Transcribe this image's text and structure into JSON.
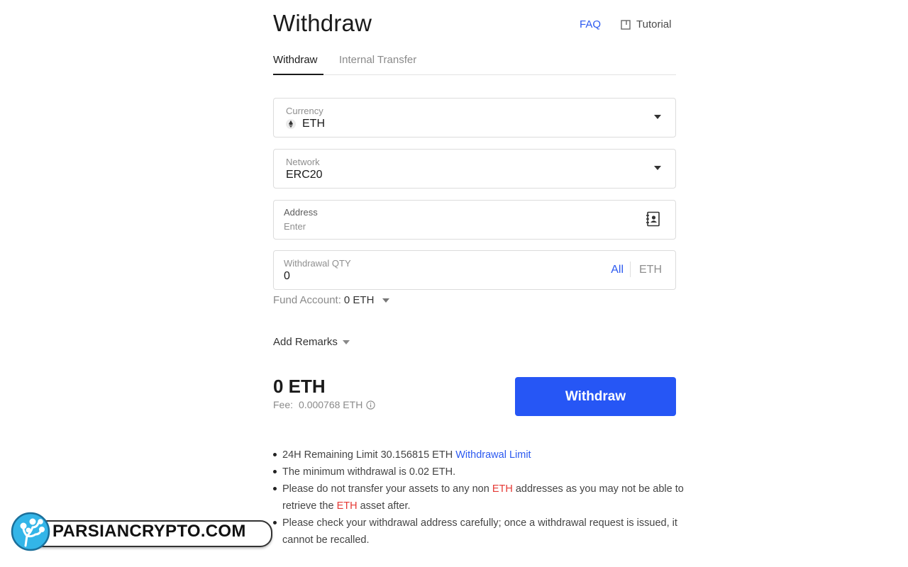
{
  "header": {
    "title": "Withdraw",
    "faq_label": "FAQ",
    "tutorial_label": "Tutorial"
  },
  "tabs": [
    {
      "label": "Withdraw",
      "active": true
    },
    {
      "label": "Internal Transfer",
      "active": false
    }
  ],
  "form": {
    "currency": {
      "label": "Currency",
      "value": "ETH",
      "icon": "ethereum-icon"
    },
    "network": {
      "label": "Network",
      "value": "ERC20"
    },
    "address": {
      "label": "Address",
      "placeholder": "Enter",
      "icon": "address-book-icon"
    },
    "qty": {
      "label": "Withdrawal QTY",
      "value": "0",
      "all_label": "All",
      "unit": "ETH"
    }
  },
  "fund_account": {
    "label": "Fund Account:",
    "value": "0 ETH"
  },
  "remarks_label": "Add Remarks",
  "summary": {
    "total": "0 ETH",
    "fee_label": "Fee:",
    "fee_value": "0.000768 ETH"
  },
  "withdraw_button": "Withdraw",
  "notes": {
    "limit_text": "24H Remaining Limit 30.156815 ETH",
    "limit_link": "Withdrawal Limit",
    "min_text": "The minimum withdrawal is 0.02 ETH.",
    "warn_part1": "Please do not transfer your assets to any non",
    "warn_coin1": "ETH",
    "warn_part2": "addresses as you may not be able to retrieve the",
    "warn_coin2": "ETH",
    "warn_part3": "asset after.",
    "check_text": "Please check your withdrawal address carefully; once a withdrawal request is issued, it cannot be recalled."
  },
  "watermark": {
    "text": "PARSIANCRYPTO.COM"
  },
  "colors": {
    "accent": "#2656f5",
    "link": "#2b59f0",
    "warning": "#e53935"
  }
}
